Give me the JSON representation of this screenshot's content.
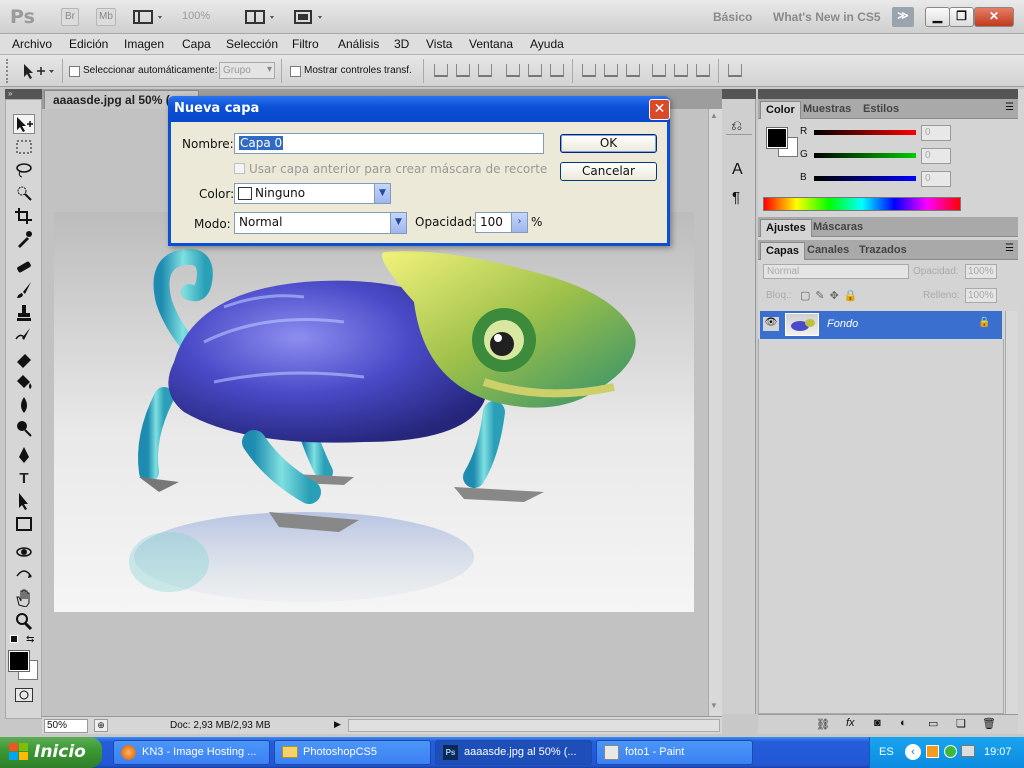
{
  "app": {
    "logo": "Ps",
    "bridge_btn": "Br",
    "minibridge_btn": "Mb",
    "zoom": "100%",
    "workspace_basic": "Básico",
    "workspace_new": "What's New in CS5",
    "more": "≫"
  },
  "menu": [
    "Archivo",
    "Edición",
    "Imagen",
    "Capa",
    "Selección",
    "Filtro",
    "Análisis",
    "3D",
    "Vista",
    "Ventana",
    "Ayuda"
  ],
  "options": {
    "auto_select_label": "Seleccionar automáticamente:",
    "auto_select_value": "Grupo",
    "show_transform_label": "Mostrar controles transf."
  },
  "document": {
    "tab_title": "aaaasde.jpg al 50% (",
    "zoom": "50%",
    "doc_info": "Doc: 2,93 MB/2,93 MB"
  },
  "dialog": {
    "title": "Nueva capa",
    "name_label": "Nombre:",
    "name_value": "Capa 0",
    "clip_label": "Usar capa anterior para crear máscara de recorte",
    "color_label": "Color:",
    "color_value": "Ninguno",
    "mode_label": "Modo:",
    "mode_value": "Normal",
    "opacity_label": "Opacidad:",
    "opacity_value": "100",
    "opacity_unit": "%",
    "ok": "OK",
    "cancel": "Cancelar"
  },
  "color_panel": {
    "tabs": [
      "Color",
      "Muestras",
      "Estilos"
    ],
    "r_label": "R",
    "g_label": "G",
    "b_label": "B",
    "r_value": "0",
    "g_value": "0",
    "b_value": "0"
  },
  "adjust_panel": {
    "tabs": [
      "Ajustes",
      "Máscaras"
    ]
  },
  "layers_panel": {
    "tabs": [
      "Capas",
      "Canales",
      "Trazados"
    ],
    "blend": "Normal",
    "opacity_label": "Opacidad:",
    "opacity_value": "100%",
    "lock_label": "Bloq.:",
    "fill_label": "Relleno:",
    "fill_value": "100%",
    "layer_name": "Fondo"
  },
  "taskbar": {
    "start": "Inicio",
    "tasks": [
      "KN3 - Image Hosting ...",
      "PhotoshopCS5",
      "aaaasde.jpg al 50% (...",
      "foto1 - Paint"
    ],
    "lang": "ES",
    "clock": "19:07"
  },
  "colors": {
    "dialog_title": "#0a4fd6",
    "selected_layer": "#3a6fd0",
    "taskbar": "#245edb",
    "start": "#3c9a35"
  }
}
